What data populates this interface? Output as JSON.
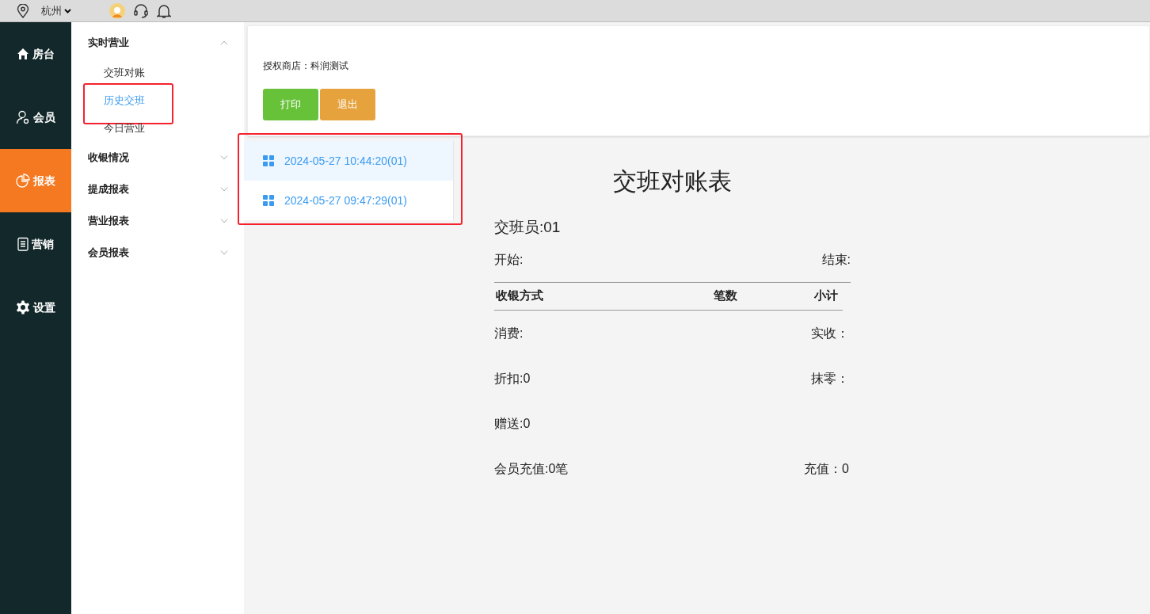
{
  "top_bar": {
    "city": "杭州"
  },
  "nav": [
    {
      "label": "房台",
      "kind": "home",
      "selected": false
    },
    {
      "label": "会员",
      "kind": "member",
      "selected": false
    },
    {
      "label": "报表",
      "kind": "chart",
      "selected": true
    },
    {
      "label": "营销",
      "kind": "clipboard",
      "selected": false
    },
    {
      "label": "设置",
      "kind": "gear",
      "selected": false
    }
  ],
  "menu": [
    {
      "label": "实时营业",
      "expanded": true,
      "children": [
        {
          "label": "交班对账",
          "selected": false,
          "highlighted": false
        },
        {
          "label": "历史交班",
          "selected": true,
          "highlighted": true
        },
        {
          "label": "今日营业",
          "selected": false,
          "highlighted": false
        }
      ]
    },
    {
      "label": "收银情况",
      "expanded": false
    },
    {
      "label": "提成报表",
      "expanded": false
    },
    {
      "label": "营业报表",
      "expanded": false
    },
    {
      "label": "会员报表",
      "expanded": false
    }
  ],
  "shop_line": "授权商店：科润测试",
  "buttons": [
    {
      "label": "打印",
      "kind": "print"
    },
    {
      "label": "退出",
      "kind": "exit"
    }
  ],
  "shift_list": {
    "highlighted": true,
    "items": [
      {
        "label": "2024-05-27 10:44:20(01)",
        "selected": true
      },
      {
        "label": "2024-05-27 09:47:29(01)",
        "selected": false
      }
    ]
  },
  "report": {
    "title": "交班对账表",
    "clerk": "交班员:01",
    "start": "开始:",
    "end": "结束:",
    "columns": [
      "收银方式",
      "笔数",
      "小计"
    ],
    "rows": [
      {
        "left": "消费:",
        "right": "实收："
      },
      {
        "left": "折扣:0",
        "right": "抹零："
      },
      {
        "left": "赠送:0"
      },
      {
        "left": "会员充值:0笔",
        "right": "充值：0"
      }
    ]
  }
}
